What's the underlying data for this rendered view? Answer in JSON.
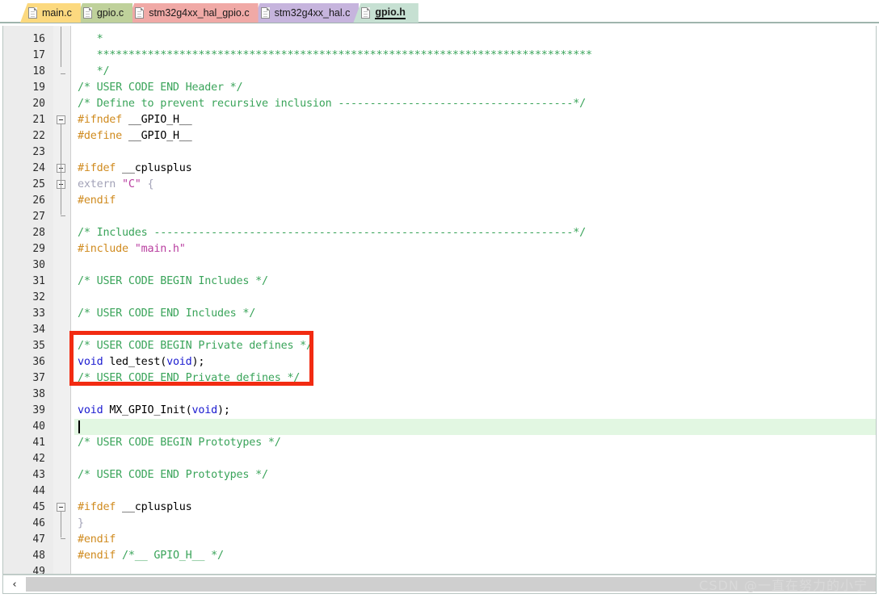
{
  "window": {
    "title": "gpio.h",
    "watermark": "CSDN @一直在努力的小宁"
  },
  "tabs": [
    {
      "label": "main.c",
      "color": "#fcd97f",
      "active": false,
      "icon": "file-icon"
    },
    {
      "label": "gpio.c",
      "color": "#bfd19b",
      "active": false,
      "icon": "file-icon"
    },
    {
      "label": "stm32g4xx_hal_gpio.c",
      "color": "#f0a9a6",
      "active": false,
      "icon": "file-icon"
    },
    {
      "label": "stm32g4xx_hal.c",
      "color": "#c6b4dd",
      "active": false,
      "icon": "file-icon"
    },
    {
      "label": "gpio.h",
      "color": "#c6e0d2",
      "active": true,
      "icon": "file-icon"
    }
  ],
  "editor": {
    "first_line": 16,
    "last_line": 49,
    "current_line": 40,
    "colors": {
      "comment": "#3aa45a",
      "preprocessor": "#d08b1f",
      "string": "#b93fa0",
      "keyword": "#1a1ad0",
      "grayed": "#a3a3b8",
      "plain": "#000000",
      "current_line_bg": "#e2f7e2",
      "gutter_bg": "#ececec",
      "annotation_box": "#f22b12"
    },
    "lines": [
      {
        "n": 16,
        "tokens": [
          {
            "t": "   *",
            "c": "cmt"
          }
        ]
      },
      {
        "n": 17,
        "tokens": [
          {
            "t": "   ******************************************************************************",
            "c": "cmt"
          }
        ]
      },
      {
        "n": 18,
        "tokens": [
          {
            "t": "   */",
            "c": "cmt"
          }
        ]
      },
      {
        "n": 19,
        "tokens": [
          {
            "t": "/* USER CODE END Header */",
            "c": "cmt"
          }
        ]
      },
      {
        "n": 20,
        "tokens": [
          {
            "t": "/* Define to prevent recursive inclusion -------------------------------------*/",
            "c": "cmt"
          }
        ]
      },
      {
        "n": 21,
        "tokens": [
          {
            "t": "#ifndef",
            "c": "pre"
          },
          {
            "t": " __GPIO_H__",
            "c": "plain"
          }
        ]
      },
      {
        "n": 22,
        "tokens": [
          {
            "t": "#define",
            "c": "pre"
          },
          {
            "t": " __GPIO_H__",
            "c": "plain"
          }
        ]
      },
      {
        "n": 23,
        "tokens": []
      },
      {
        "n": 24,
        "tokens": [
          {
            "t": "#ifdef",
            "c": "pre"
          },
          {
            "t": " __cplusplus",
            "c": "plain"
          }
        ]
      },
      {
        "n": 25,
        "tokens": [
          {
            "t": "extern ",
            "c": "gry"
          },
          {
            "t": "\"C\"",
            "c": "str"
          },
          {
            "t": " {",
            "c": "gry"
          }
        ]
      },
      {
        "n": 26,
        "tokens": [
          {
            "t": "#endif",
            "c": "pre"
          }
        ]
      },
      {
        "n": 27,
        "tokens": []
      },
      {
        "n": 28,
        "tokens": [
          {
            "t": "/* Includes ------------------------------------------------------------------*/",
            "c": "cmt"
          }
        ]
      },
      {
        "n": 29,
        "tokens": [
          {
            "t": "#include ",
            "c": "pre"
          },
          {
            "t": "\"main.h\"",
            "c": "str"
          }
        ]
      },
      {
        "n": 30,
        "tokens": []
      },
      {
        "n": 31,
        "tokens": [
          {
            "t": "/* USER CODE BEGIN Includes */",
            "c": "cmt"
          }
        ]
      },
      {
        "n": 32,
        "tokens": []
      },
      {
        "n": 33,
        "tokens": [
          {
            "t": "/* USER CODE END Includes */",
            "c": "cmt"
          }
        ]
      },
      {
        "n": 34,
        "tokens": []
      },
      {
        "n": 35,
        "tokens": [
          {
            "t": "/* USER CODE BEGIN Private defines */",
            "c": "cmt"
          }
        ]
      },
      {
        "n": 36,
        "tokens": [
          {
            "t": "void",
            "c": "kw"
          },
          {
            "t": " led_test(",
            "c": "plain"
          },
          {
            "t": "void",
            "c": "kw"
          },
          {
            "t": ");",
            "c": "plain"
          }
        ]
      },
      {
        "n": 37,
        "tokens": [
          {
            "t": "/* USER CODE END Private defines */",
            "c": "cmt"
          }
        ]
      },
      {
        "n": 38,
        "tokens": []
      },
      {
        "n": 39,
        "tokens": [
          {
            "t": "void",
            "c": "kw"
          },
          {
            "t": " MX_GPIO_Init(",
            "c": "plain"
          },
          {
            "t": "void",
            "c": "kw"
          },
          {
            "t": ");",
            "c": "plain"
          }
        ]
      },
      {
        "n": 40,
        "tokens": []
      },
      {
        "n": 41,
        "tokens": [
          {
            "t": "/* USER CODE BEGIN Prototypes */",
            "c": "cmt"
          }
        ]
      },
      {
        "n": 42,
        "tokens": []
      },
      {
        "n": 43,
        "tokens": [
          {
            "t": "/* USER CODE END Prototypes */",
            "c": "cmt"
          }
        ]
      },
      {
        "n": 44,
        "tokens": []
      },
      {
        "n": 45,
        "tokens": [
          {
            "t": "#ifdef",
            "c": "pre"
          },
          {
            "t": " __cplusplus",
            "c": "plain"
          }
        ]
      },
      {
        "n": 46,
        "tokens": [
          {
            "t": "}",
            "c": "gry"
          }
        ]
      },
      {
        "n": 47,
        "tokens": [
          {
            "t": "#endif",
            "c": "pre"
          }
        ]
      },
      {
        "n": 48,
        "tokens": [
          {
            "t": "#endif ",
            "c": "pre"
          },
          {
            "t": "/*__ GPIO_H__ */",
            "c": "cmt"
          }
        ]
      },
      {
        "n": 49,
        "tokens": []
      }
    ],
    "fold_widgets": [
      {
        "line": 21,
        "type": "collapse-box"
      },
      {
        "line": 24,
        "type": "collapse-box"
      },
      {
        "line": 25,
        "type": "collapse-box"
      },
      {
        "line": 45,
        "type": "collapse-box"
      }
    ],
    "annotation": {
      "shape": "rectangle",
      "covers_lines": [
        35,
        36,
        37
      ],
      "color": "#f22b12"
    }
  },
  "scrollbar": {
    "left_arrow": "‹",
    "orientation": "horizontal"
  }
}
